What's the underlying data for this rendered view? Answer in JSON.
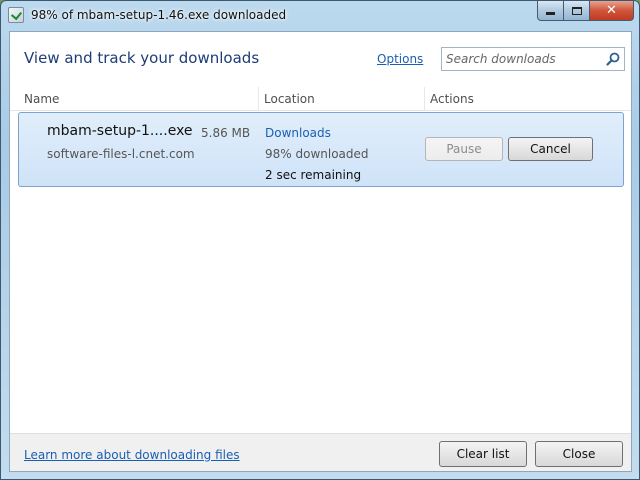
{
  "window": {
    "title": "98% of mbam-setup-1.46.exe downloaded"
  },
  "header": {
    "title": "View and track your downloads",
    "options_label": "Options",
    "search_placeholder": "Search downloads"
  },
  "columns": {
    "name": "Name",
    "location": "Location",
    "actions": "Actions"
  },
  "download": {
    "file_name": "mbam-setup-1....exe",
    "size": "5.86 MB",
    "source": "software-files-l.cnet.com",
    "location_link": "Downloads",
    "progress_text": "98% downloaded",
    "progress_fraction": 0.98,
    "remaining": "2 sec remaining",
    "pause_label": "Pause",
    "cancel_label": "Cancel"
  },
  "footer": {
    "learn_more": "Learn more about downloading files",
    "clear_list": "Clear list",
    "close": "Close"
  },
  "colors": {
    "accent_link": "#1a5fb4",
    "selected_row": "#cfe3f8",
    "header_title": "#1e3c78"
  }
}
